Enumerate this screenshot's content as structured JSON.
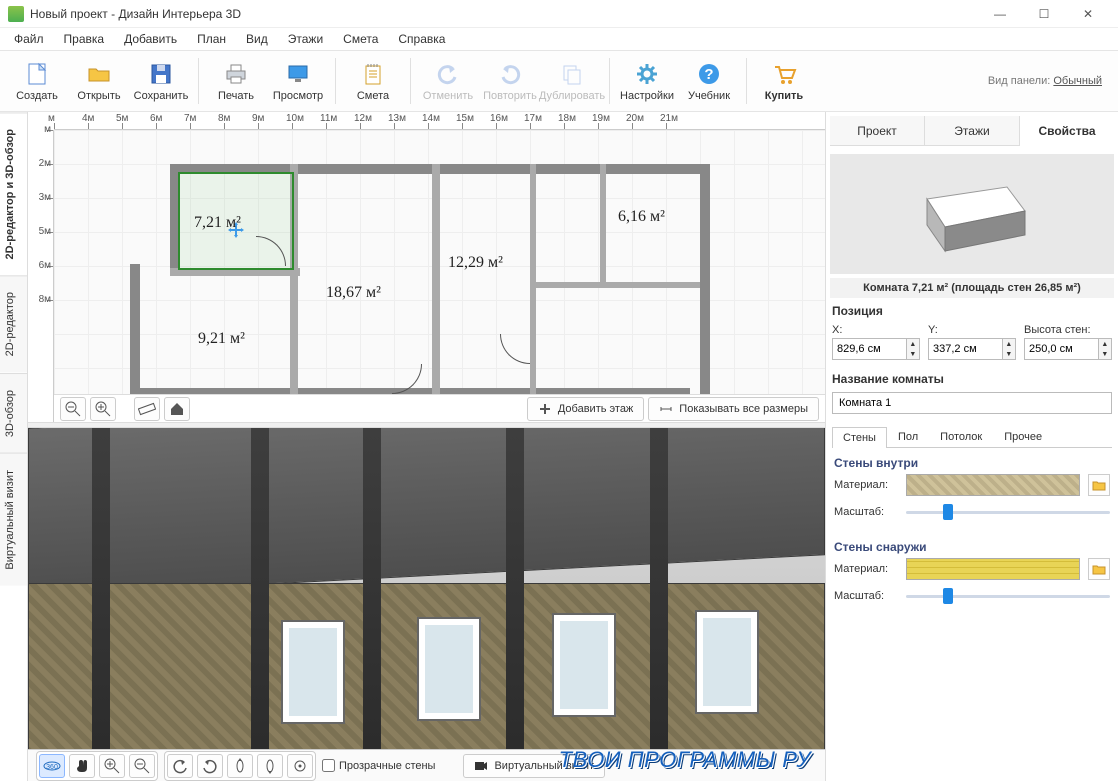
{
  "window": {
    "title": "Новый проект - Дизайн Интерьера 3D"
  },
  "menu": {
    "items": [
      "Файл",
      "Правка",
      "Добавить",
      "План",
      "Вид",
      "Этажи",
      "Смета",
      "Справка"
    ]
  },
  "toolbar": {
    "create": "Создать",
    "open": "Открыть",
    "save": "Сохранить",
    "print": "Печать",
    "preview": "Просмотр",
    "estimate": "Смета",
    "undo": "Отменить",
    "redo": "Повторить",
    "duplicate": "Дублировать",
    "settings": "Настройки",
    "tutorial": "Учебник",
    "buy": "Купить",
    "panel_label": "Вид панели:",
    "panel_mode": "Обычный"
  },
  "sidetabs": {
    "items": [
      "2D-редактор и 3D-обзор",
      "2D-редактор",
      "3D-обзор",
      "Виртуальный визит"
    ]
  },
  "ruler": {
    "h": [
      "м",
      "4м",
      "5м",
      "6м",
      "7м",
      "8м",
      "9м",
      "10м",
      "11м",
      "12м",
      "13м",
      "14м",
      "15м",
      "16м",
      "17м",
      "18м",
      "19м",
      "20м",
      "21м"
    ],
    "v": [
      "м",
      "2м",
      "3м",
      "5м",
      "6м",
      "8м"
    ]
  },
  "rooms": {
    "r1": "7,21 м²",
    "r2": "18,67 м²",
    "r3": "12,29 м²",
    "r4": "6,16 м²",
    "r5": "9,21 м²"
  },
  "bar2d": {
    "add_floor": "Добавить этаж",
    "show_dims": "Показывать все размеры"
  },
  "bar3d": {
    "transparent": "Прозрачные стены",
    "virtual": "Виртуальный визит"
  },
  "props": {
    "tabs": [
      "Проект",
      "Этажи",
      "Свойства"
    ],
    "room_title": "Комната 7,21 м²  (площадь стен 26,85 м²)",
    "position": "Позиция",
    "x_label": "X:",
    "y_label": "Y:",
    "h_label": "Высота стен:",
    "x": "829,6 см",
    "y": "337,2 см",
    "h": "250,0 см",
    "name_label": "Название комнаты",
    "name": "Комната 1",
    "subtabs": [
      "Стены",
      "Пол",
      "Потолок",
      "Прочее"
    ],
    "walls_in": "Стены внутри",
    "walls_out": "Стены снаружи",
    "material": "Материал:",
    "scale": "Масштаб:"
  },
  "watermark": "ТВОИ ПРОГРАММЫ РУ"
}
